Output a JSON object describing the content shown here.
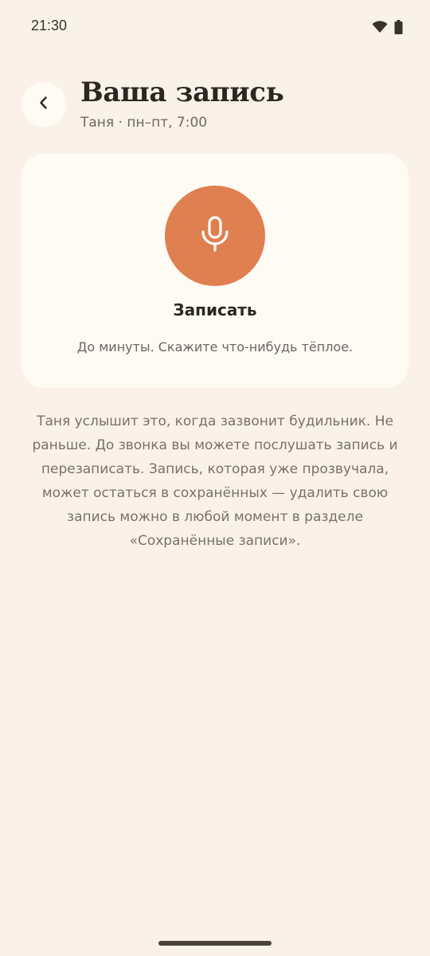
{
  "status_bar": {
    "time": "21:30",
    "icons": [
      "wifi-icon",
      "battery-icon"
    ]
  },
  "header": {
    "back_icon": "chevron-left-icon",
    "title": "Ваша запись",
    "subtitle": "Таня · пн–пт, 7:00"
  },
  "record_card": {
    "mic_icon": "microphone-icon",
    "button_label": "Записать",
    "hint": "До минуты. Скажите что-нибудь тёплое."
  },
  "info": {
    "text": "Таня услышит это, когда зазвонит будильник. Не раньше. До звонка вы можете послушать запись и перезаписать. Запись, которая уже прозвучала, может остаться в сохранённых — удалить свою запись можно в любой момент в разделе «Сохранённые записи»."
  },
  "colors": {
    "background": "#FAF2E8",
    "card": "#FEFBF4",
    "accent": "#E07F4F",
    "text_primary": "#2E2620",
    "text_secondary": "#6F655C"
  }
}
